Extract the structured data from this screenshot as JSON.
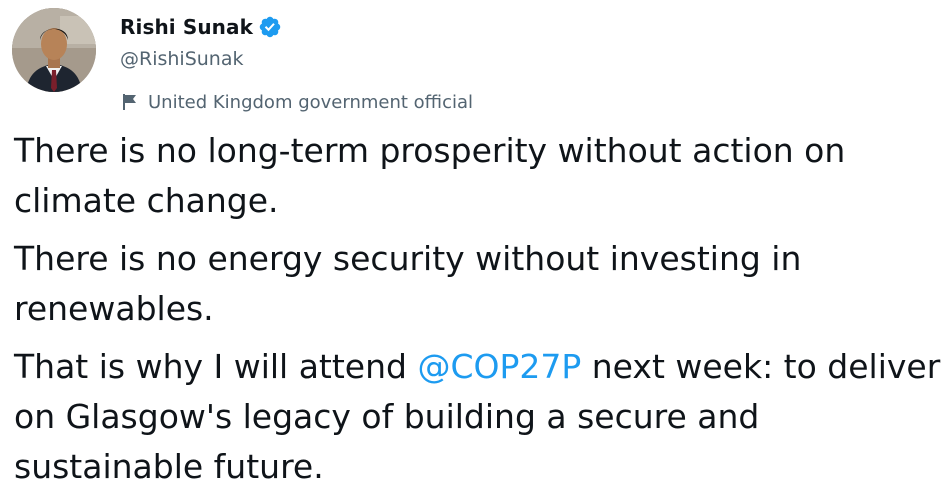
{
  "author": {
    "display_name": "Rishi Sunak",
    "handle": "@RishiSunak",
    "verified_icon": "verified-badge-icon",
    "affiliation": "United Kingdom government official",
    "affiliation_icon": "flag-icon"
  },
  "tweet": {
    "para1": "There is no long-term prosperity without action on climate change.",
    "para2": "There is no energy security without investing in renewables.",
    "para3_before": "That is why I will attend ",
    "para3_mention": "@COP27P",
    "para3_after": " next week: to deliver on Glasgow's legacy of building a secure and sustainable future."
  },
  "colors": {
    "text": "#0f1419",
    "secondary": "#536471",
    "accent": "#1d9bf0"
  }
}
